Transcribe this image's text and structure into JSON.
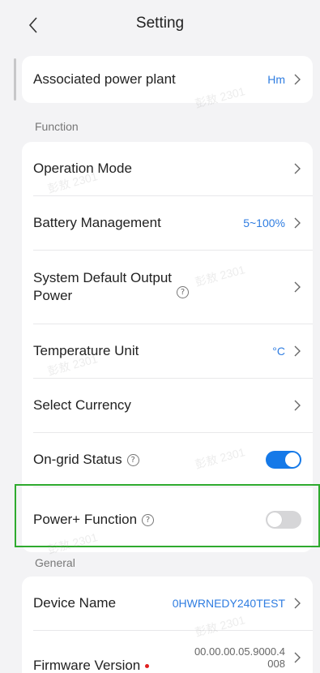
{
  "header": {
    "title": "Setting"
  },
  "plant": {
    "label": "Associated power plant",
    "value": "Hm"
  },
  "sections": {
    "function": "Function",
    "general": "General"
  },
  "function_rows": {
    "operation_mode": {
      "label": "Operation Mode"
    },
    "battery": {
      "label": "Battery Management",
      "value": "5~100%"
    },
    "output_power": {
      "label_line1": "System Default Output",
      "label_line2": "Power"
    },
    "temperature": {
      "label": "Temperature Unit",
      "value": "°C"
    },
    "currency": {
      "label": "Select Currency"
    },
    "ongrid": {
      "label": "On-grid Status",
      "state": "on"
    },
    "powerplus": {
      "label": "Power+ Function",
      "state": "off"
    }
  },
  "general_rows": {
    "device_name": {
      "label": "Device Name",
      "value": "0HWRNEDY240TEST"
    },
    "firmware": {
      "label": "Firmware Version",
      "value_line1": "00.00.00.05.9000.4",
      "value_line2": "008"
    }
  },
  "watermark_text": "彭敖 2301",
  "colors": {
    "accent": "#1579e8",
    "link": "#2f7de1",
    "highlight": "#2eaa2e",
    "alert": "#e02020"
  }
}
